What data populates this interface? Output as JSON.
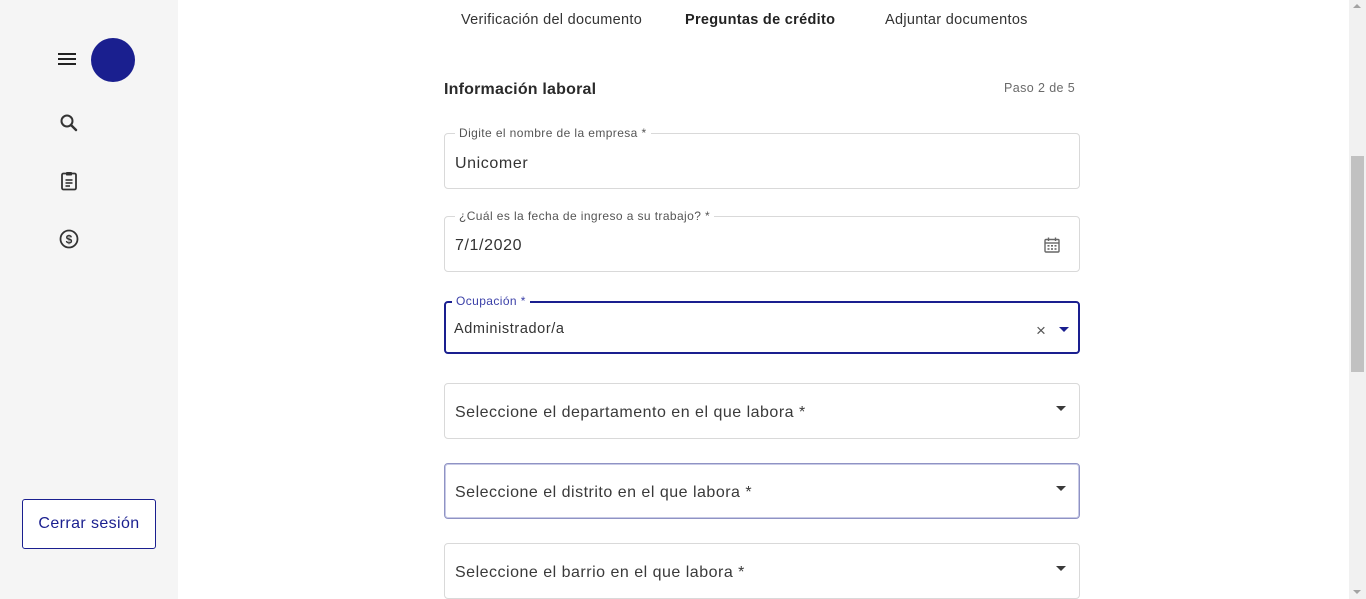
{
  "sidebar": {
    "menu_icon": "hamburger-menu-icon",
    "avatar_color": "#1a1f8f",
    "nav_icons": [
      "search-icon",
      "clipboard-icon",
      "dollar-circle-icon"
    ],
    "logout_label": "Cerrar sesión"
  },
  "tabs": [
    {
      "label": "Verificación del documento",
      "active": false
    },
    {
      "label": "Preguntas de crédito",
      "active": true
    },
    {
      "label": "Adjuntar documentos",
      "active": false
    }
  ],
  "section": {
    "title": "Información laboral",
    "step": "Paso 2 de 5"
  },
  "form": {
    "company": {
      "label": "Digite el nombre de la empresa *",
      "value": "Unicomer"
    },
    "start_date": {
      "label": "¿Cuál es la fecha de ingreso a su trabajo? *",
      "value": "7/1/2020",
      "icon": "calendar-icon"
    },
    "occupation": {
      "label": "Ocupación *",
      "value": "Administrador/a",
      "clear_icon": "×"
    },
    "department": {
      "placeholder": "Seleccione el departamento en el que labora *"
    },
    "district": {
      "placeholder": "Seleccione el distrito en el que labora *"
    },
    "neighborhood": {
      "placeholder": "Seleccione el barrio en el que labora *"
    }
  },
  "colors": {
    "accent": "#1a1f8f",
    "focus_label": "#3b40a8",
    "sidebar_bg": "#f5f5f5",
    "border": "#d9d9d9"
  }
}
